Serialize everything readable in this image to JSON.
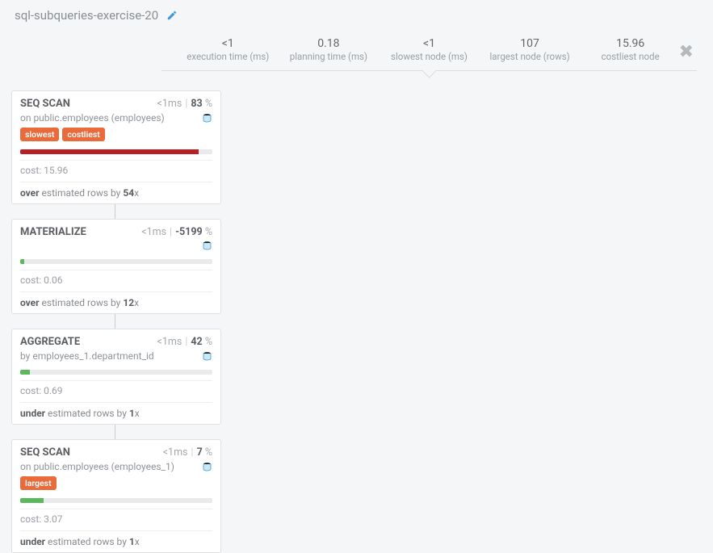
{
  "title": "sql-subqueries-exercise-20",
  "stats": [
    {
      "value": "<1",
      "label": "execution time (ms)"
    },
    {
      "value": "0.18",
      "label": "planning time (ms)"
    },
    {
      "value": "<1",
      "label": "slowest node (ms)"
    },
    {
      "value": "107",
      "label": "largest node (rows)"
    },
    {
      "value": "15.96",
      "label": "costliest node"
    }
  ],
  "nodes": [
    {
      "op": "SEQ SCAN",
      "time": "<1",
      "time_unit": "ms",
      "pct": "83",
      "target": "on public.employees (employees)",
      "tags": [
        "slowest",
        "costliest"
      ],
      "bar_color": "#b52025",
      "bar_width": "93%",
      "cost": "15.96",
      "est_dir": "over",
      "est_mid": " estimated rows by ",
      "est_factor": "54"
    },
    {
      "op": "MATERIALIZE",
      "time": "<1",
      "time_unit": "ms",
      "pct": "-5199",
      "target": "",
      "tags": [],
      "bar_color": "#5cb85c",
      "bar_width": "2%",
      "cost": "0.06",
      "est_dir": "over",
      "est_mid": " estimated rows by ",
      "est_factor": "12"
    },
    {
      "op": "AGGREGATE",
      "time": "<1",
      "time_unit": "ms",
      "pct": "42",
      "target": "by employees_1.department_id",
      "tags": [],
      "bar_color": "#5cb85c",
      "bar_width": "5%",
      "cost": "0.69",
      "est_dir": "under",
      "est_mid": " estimated rows by ",
      "est_factor": "1"
    },
    {
      "op": "SEQ SCAN",
      "time": "<1",
      "time_unit": "ms",
      "pct": "7",
      "target": "on public.employees (employees_1)",
      "tags": [
        "largest"
      ],
      "bar_color": "#5cb85c",
      "bar_width": "12%",
      "cost": "3.07",
      "est_dir": "under",
      "est_mid": " estimated rows by ",
      "est_factor": "1"
    }
  ],
  "labels": {
    "cost_prefix": "cost: ",
    "x_suffix": "x",
    "pct_suffix": " %"
  }
}
